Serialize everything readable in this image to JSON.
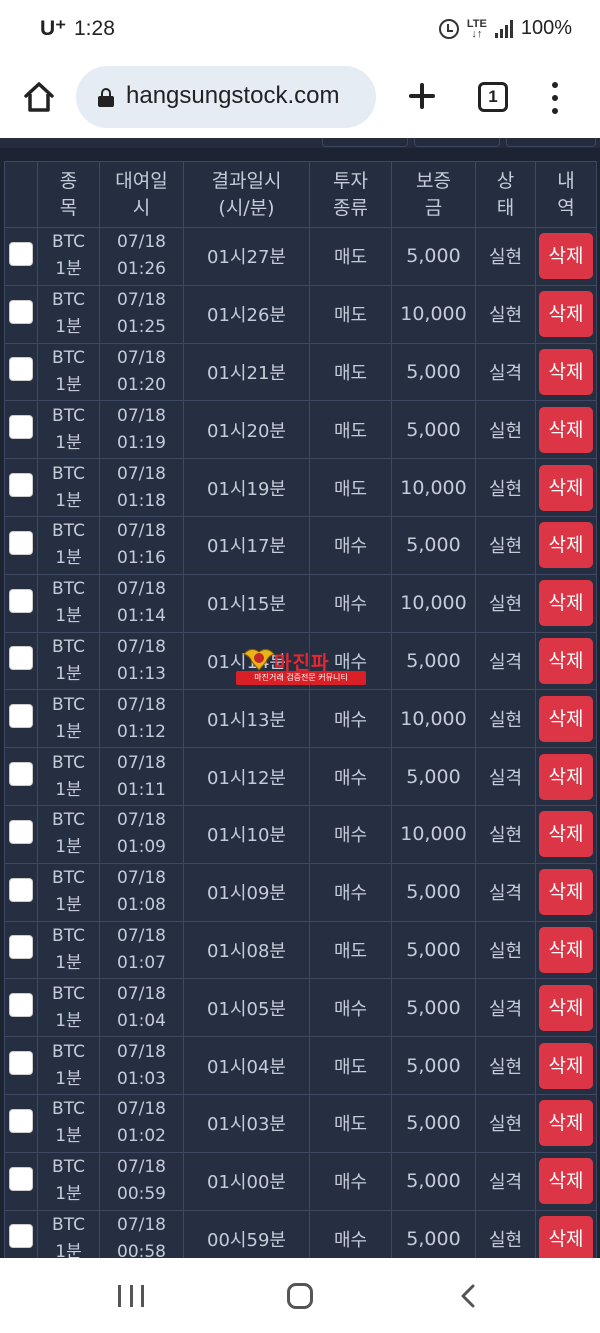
{
  "status_bar": {
    "carrier": "U⁺",
    "time": "1:28",
    "network": "LTE",
    "battery": "100%",
    "icons": [
      "alarm-icon",
      "lte-icon",
      "signal-icon"
    ]
  },
  "browser": {
    "url": "hangsungstock.com",
    "tab_count": "1",
    "icons": [
      "home-icon",
      "lock-icon",
      "plus-icon",
      "tabs-icon",
      "menu-icon"
    ]
  },
  "table": {
    "headers": {
      "item": "종\n목",
      "rent_date": "대여일\n시",
      "result_time": "결과일시\n(시/분)",
      "invest_type": "투자\n종류",
      "deposit": "보증\n금",
      "status": "상\n태",
      "detail": "내\n역"
    },
    "rows": [
      {
        "item": "BTC\n1분",
        "rent": "07/18\n01:26",
        "result": "01시27분",
        "type": "매도",
        "deposit": "5,000",
        "status": "실현",
        "win": true,
        "action": "삭제"
      },
      {
        "item": "BTC\n1분",
        "rent": "07/18\n01:25",
        "result": "01시26분",
        "type": "매도",
        "deposit": "10,000",
        "status": "실현",
        "win": true,
        "action": "삭제"
      },
      {
        "item": "BTC\n1분",
        "rent": "07/18\n01:20",
        "result": "01시21분",
        "type": "매도",
        "deposit": "5,000",
        "status": "실격",
        "win": false,
        "action": "삭제"
      },
      {
        "item": "BTC\n1분",
        "rent": "07/18\n01:19",
        "result": "01시20분",
        "type": "매도",
        "deposit": "5,000",
        "status": "실현",
        "win": true,
        "action": "삭제"
      },
      {
        "item": "BTC\n1분",
        "rent": "07/18\n01:18",
        "result": "01시19분",
        "type": "매도",
        "deposit": "10,000",
        "status": "실현",
        "win": true,
        "action": "삭제"
      },
      {
        "item": "BTC\n1분",
        "rent": "07/18\n01:16",
        "result": "01시17분",
        "type": "매수",
        "deposit": "5,000",
        "status": "실현",
        "win": true,
        "action": "삭제"
      },
      {
        "item": "BTC\n1분",
        "rent": "07/18\n01:14",
        "result": "01시15분",
        "type": "매수",
        "deposit": "10,000",
        "status": "실현",
        "win": true,
        "action": "삭제"
      },
      {
        "item": "BTC\n1분",
        "rent": "07/18\n01:13",
        "result": "01시14분",
        "type": "매수",
        "deposit": "5,000",
        "status": "실격",
        "win": false,
        "action": "삭제"
      },
      {
        "item": "BTC\n1분",
        "rent": "07/18\n01:12",
        "result": "01시13분",
        "type": "매수",
        "deposit": "10,000",
        "status": "실현",
        "win": true,
        "action": "삭제"
      },
      {
        "item": "BTC\n1분",
        "rent": "07/18\n01:11",
        "result": "01시12분",
        "type": "매수",
        "deposit": "5,000",
        "status": "실격",
        "win": false,
        "action": "삭제"
      },
      {
        "item": "BTC\n1분",
        "rent": "07/18\n01:09",
        "result": "01시10분",
        "type": "매수",
        "deposit": "10,000",
        "status": "실현",
        "win": true,
        "action": "삭제"
      },
      {
        "item": "BTC\n1분",
        "rent": "07/18\n01:08",
        "result": "01시09분",
        "type": "매수",
        "deposit": "5,000",
        "status": "실격",
        "win": false,
        "action": "삭제"
      },
      {
        "item": "BTC\n1분",
        "rent": "07/18\n01:07",
        "result": "01시08분",
        "type": "매도",
        "deposit": "5,000",
        "status": "실현",
        "win": true,
        "action": "삭제"
      },
      {
        "item": "BTC\n1분",
        "rent": "07/18\n01:04",
        "result": "01시05분",
        "type": "매수",
        "deposit": "5,000",
        "status": "실격",
        "win": false,
        "action": "삭제"
      },
      {
        "item": "BTC\n1분",
        "rent": "07/18\n01:03",
        "result": "01시04분",
        "type": "매도",
        "deposit": "5,000",
        "status": "실현",
        "win": true,
        "action": "삭제"
      },
      {
        "item": "BTC\n1분",
        "rent": "07/18\n01:02",
        "result": "01시03분",
        "type": "매도",
        "deposit": "5,000",
        "status": "실현",
        "win": true,
        "action": "삭제"
      },
      {
        "item": "BTC\n1분",
        "rent": "07/18\n00:59",
        "result": "01시00분",
        "type": "매수",
        "deposit": "5,000",
        "status": "실격",
        "win": false,
        "action": "삭제"
      },
      {
        "item": "BTC\n1분",
        "rent": "07/18\n00:58",
        "result": "00시59분",
        "type": "매수",
        "deposit": "5,000",
        "status": "실현",
        "win": true,
        "action": "삭제"
      }
    ]
  },
  "watermark": {
    "title": "마진파",
    "subtitle": "마진거래 검증전문 커뮤니티"
  },
  "colors": {
    "background": "#1c2333",
    "cell": "#262e42",
    "border": "#3e4862",
    "win": "#4cc26a",
    "loss": "#e8333c",
    "delete_button": "#dc3545"
  },
  "nav_bar": {
    "icons": [
      "recents-icon",
      "home-nav-icon",
      "back-icon"
    ]
  }
}
